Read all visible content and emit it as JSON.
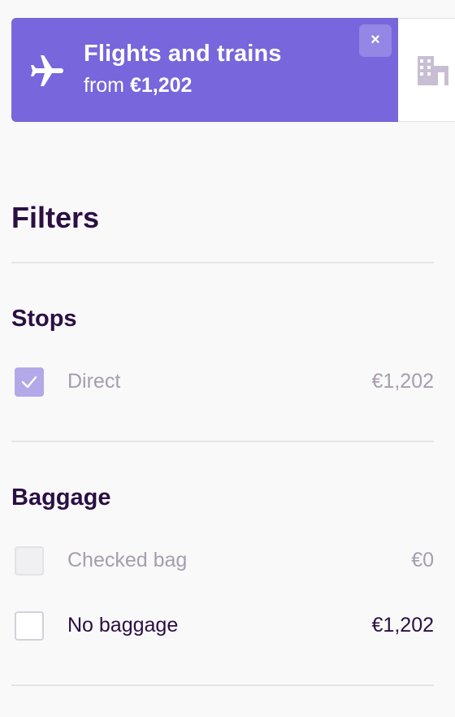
{
  "card": {
    "title": "Flights and trains",
    "subtitle_prefix": "from",
    "subtitle_price": "€1,202",
    "close_label": "×",
    "accent_color": "#7766dc",
    "icon": "airplane-icon",
    "secondary_icon": "building-icon"
  },
  "filters": {
    "title": "Filters",
    "sections": {
      "stops": {
        "title": "Stops",
        "options": [
          {
            "label": "Direct",
            "price": "€1,202",
            "checked": true,
            "disabled": true
          }
        ]
      },
      "baggage": {
        "title": "Baggage",
        "options": [
          {
            "label": "Checked bag",
            "price": "€0",
            "checked": false,
            "disabled": true
          },
          {
            "label": "No baggage",
            "price": "€1,202",
            "checked": false,
            "disabled": false
          }
        ]
      }
    }
  }
}
